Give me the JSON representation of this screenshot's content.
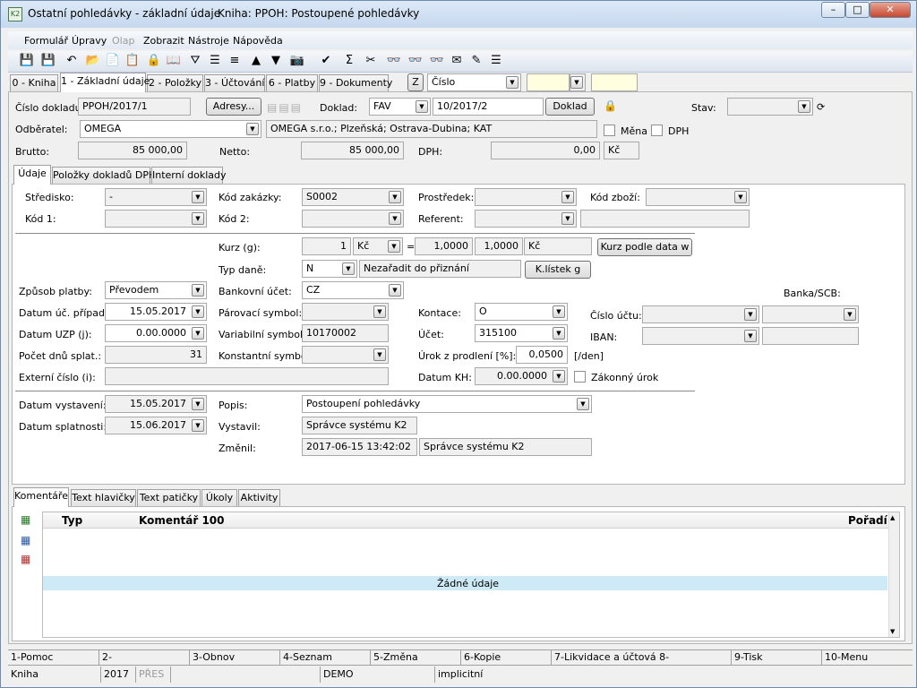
{
  "window": {
    "title": "Ostatní pohledávky - základní údaje",
    "book": "Kniha: PPOH: Postoupené pohledávky",
    "min": "–",
    "max": "□",
    "close": "✕"
  },
  "menu": [
    "Formulář",
    "Úpravy",
    "Olap",
    "Zobrazit",
    "Nástroje",
    "Nápověda"
  ],
  "toolbar_icons": [
    "save-icon",
    "save-as-icon",
    "undo-icon",
    "open-folder-icon",
    "new-doc-icon",
    "copy-icon",
    "lock-icon",
    "book-icon",
    "filter-icon",
    "filter-list-icon",
    "stack-icon",
    "arrow-up-icon",
    "arrow-down-icon",
    "camera-icon",
    "recalc-icon",
    "sigma-icon",
    "scissors-icon",
    "binoculars-icon",
    "binoculars-next-icon",
    "binoculars-prev-icon",
    "mail-icon",
    "edit-icon",
    "list-icon"
  ],
  "toolbar_glyphs": [
    "💾",
    "💾",
    "↶",
    "📂",
    "📄",
    "📋",
    "🔒",
    "📖",
    "⛛",
    "☰",
    "≡",
    "▲",
    "▼",
    "📷",
    "✔",
    "Σ",
    "✂",
    "👓",
    "👓",
    "👓",
    "✉",
    "✎",
    "☰"
  ],
  "tabs": [
    "0 - Kniha",
    "1 - Základní údaje",
    "2 - Položky",
    "3 - Účtování",
    "6 - Platby",
    "9 - Dokumenty"
  ],
  "sort": {
    "key": "Z",
    "value": "Číslo"
  },
  "header": {
    "cislo_dokladu_label": "Číslo dokladu:",
    "cislo_dokladu": "PPOH/2017/1",
    "adresy_btn": "Adresy...",
    "doklad_label": "Doklad:",
    "doklad_type": "FAV",
    "doklad_no": "10/2017/2",
    "doklad_btn": "Doklad",
    "stav_label": "Stav:",
    "stav": "",
    "odberatel_label": "Odběratel:",
    "odberatel": "OMEGA",
    "odberatel_desc": "OMEGA s.r.o.; Plzeňská; Ostrava-Dubina; KAT",
    "mena_label": "Měna",
    "dph_chk_label": "DPH",
    "brutto_label": "Brutto:",
    "brutto": "85 000,00",
    "netto_label": "Netto:",
    "netto": "85 000,00",
    "dph_label": "DPH:",
    "dph": "0,00",
    "currency": "Kč"
  },
  "subtabs": [
    "Údaje",
    "Položky dokladů DPH",
    "Interní doklady"
  ],
  "udaje": {
    "stredisko_label": "Středisko:",
    "stredisko": "-",
    "kod_zakazky_label": "Kód zakázky:",
    "kod_zakazky": "S0002",
    "prostredek_label": "Prostředek:",
    "prostredek": "",
    "kod_zbozi_label": "Kód zboží:",
    "kod_zbozi": "",
    "kod1_label": "Kód 1:",
    "kod1": "",
    "kod2_label": "Kód 2:",
    "kod2": "",
    "referent_label": "Referent:",
    "referent": "",
    "referent_name": "",
    "kurz_label": "Kurz (g):",
    "kurz_amount": "1",
    "kurz_cur": "Kč",
    "kurz_eq": "=",
    "kurz_rate": "1,0000",
    "kurz_rate2": "1,0000",
    "kurz_cur2": "Kč",
    "kurz_btn": "Kurz podle data w",
    "typ_dane_label": "Typ daně:",
    "typ_dane": "N",
    "typ_dane_desc": "Nezařadit do přiznání",
    "klistek_btn": "K.lístek g",
    "zpusob_platby_label": "Způsob platby:",
    "zpusob_platby": "Převodem",
    "bankovni_ucet_label": "Bankovní účet:",
    "bankovni_ucet": "CZ",
    "banka_scb_label": "Banka/SCB:",
    "datum_uc_label": "Datum úč. případu:",
    "datum_uc": "15.05.2017",
    "parovaci_label": "Párovací symbol:",
    "parovaci": "",
    "kontace_label": "Kontace:",
    "kontace": "O",
    "cislo_uctu_label": "Číslo účtu:",
    "cislo_uctu": "",
    "banka": "",
    "datum_uzp_label": "Datum UZP (j):",
    "datum_uzp": "0.00.0000",
    "variabilni_label": "Variabilní symbol:",
    "variabilni": "10170002",
    "ucet_label": "Účet:",
    "ucet": "315100",
    "iban_label": "IBAN:",
    "iban": "",
    "swift": "",
    "pocet_dnu_label": "Počet dnů splat.:",
    "pocet_dnu": "31",
    "konstantni_label": "Konstantní symbol:",
    "konstantni": "",
    "urok_label": "Úrok z prodlení [%]:",
    "urok": "0,0500",
    "urok_unit": "[/den]",
    "externi_label": "Externí číslo (i):",
    "externi": "",
    "datum_kh_label": "Datum KH:",
    "datum_kh": "0.00.0000",
    "zakonny_label": "Zákonný úrok",
    "datum_vyst_label": "Datum vystavení:",
    "datum_vyst": "15.05.2017",
    "popis_label": "Popis:",
    "popis": "Postoupení pohledávky",
    "datum_splat_label": "Datum splatnosti:",
    "datum_splat": "15.06.2017",
    "vystavil_label": "Vystavil:",
    "vystavil": "Správce systému K2",
    "zmenil_label": "Změnil:",
    "zmenil_date": "2017-06-15 13:42:02",
    "zmenil_user": "Správce systému K2"
  },
  "bottom_tabs": [
    "Komentáře",
    "Text hlavičky",
    "Text patičky",
    "Úkoly",
    "Aktivity"
  ],
  "comments": {
    "col_typ": "Typ",
    "col_komentar": "Komentář 100",
    "col_poradi": "Pořadí",
    "empty": "Žádné údaje"
  },
  "fkeys": [
    "1-Pomoc",
    "2-",
    "3-Obnov",
    "4-Seznam",
    "5-Změna",
    "6-Kopie",
    "7-Likvidace a účtová 8-",
    "9-Tisk",
    "10-Menu"
  ],
  "statusbar": [
    "Kniha",
    "2017",
    "PŘES",
    "",
    "DEMO",
    "implicitní"
  ]
}
